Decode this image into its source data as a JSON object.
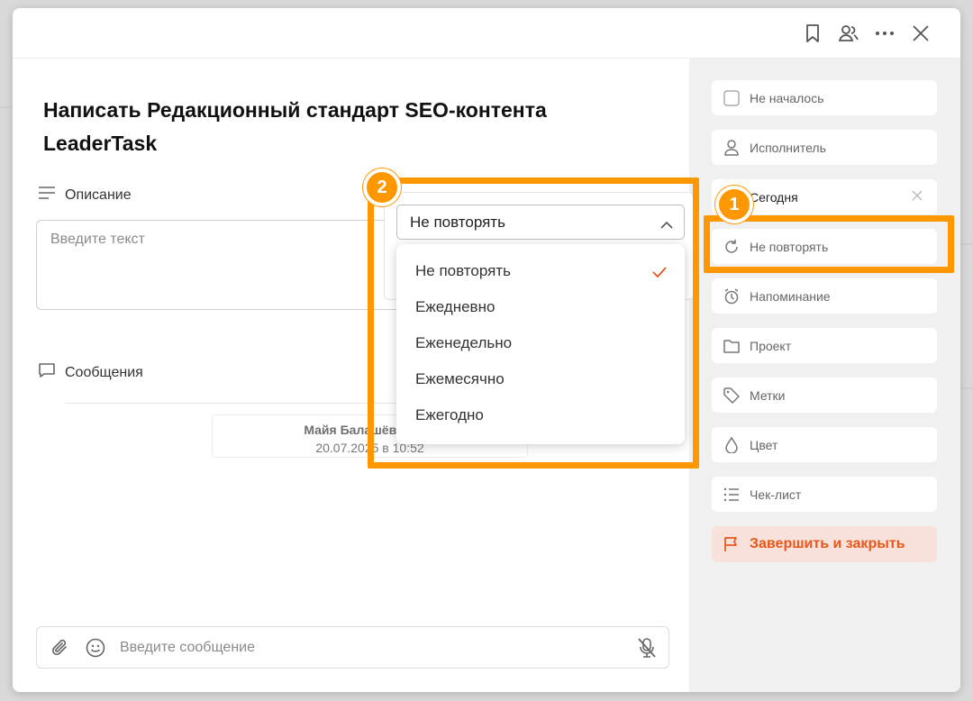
{
  "task": {
    "title": "Написать Редакционный стандарт SEO-контента LeaderTask"
  },
  "description": {
    "label": "Описание",
    "placeholder": "Введите текст"
  },
  "messages": {
    "label": "Сообщения",
    "author_line": "Майя Балашёва созд",
    "timestamp_line": "20.07.2025 в 10:52"
  },
  "composer": {
    "placeholder": "Введите сообщение"
  },
  "sidebar": {
    "items": [
      {
        "label": "Не началось",
        "icon": "checkbox-icon"
      },
      {
        "label": "Исполнитель",
        "icon": "user-icon"
      },
      {
        "label": "Сегодня",
        "icon": "calendar-icon"
      },
      {
        "label": "Не повторять",
        "icon": "repeat-icon"
      },
      {
        "label": "Напоминание",
        "icon": "alarm-icon"
      },
      {
        "label": "Проект",
        "icon": "folder-icon"
      },
      {
        "label": "Метки",
        "icon": "tag-icon"
      },
      {
        "label": "Цвет",
        "icon": "drop-icon"
      },
      {
        "label": "Чек-лист",
        "icon": "checklist-icon"
      }
    ],
    "finish_label": "Завершить и закрыть"
  },
  "repeat": {
    "selected": "Не повторять",
    "options": [
      "Не повторять",
      "Ежедневно",
      "Еженедельно",
      "Ежемесячно",
      "Ежегодно"
    ]
  },
  "callouts": {
    "one": "1",
    "two": "2"
  },
  "colors": {
    "accent": "#e8561a",
    "highlight": "#ff9800",
    "sidebar_bg": "#f0f0f1"
  }
}
